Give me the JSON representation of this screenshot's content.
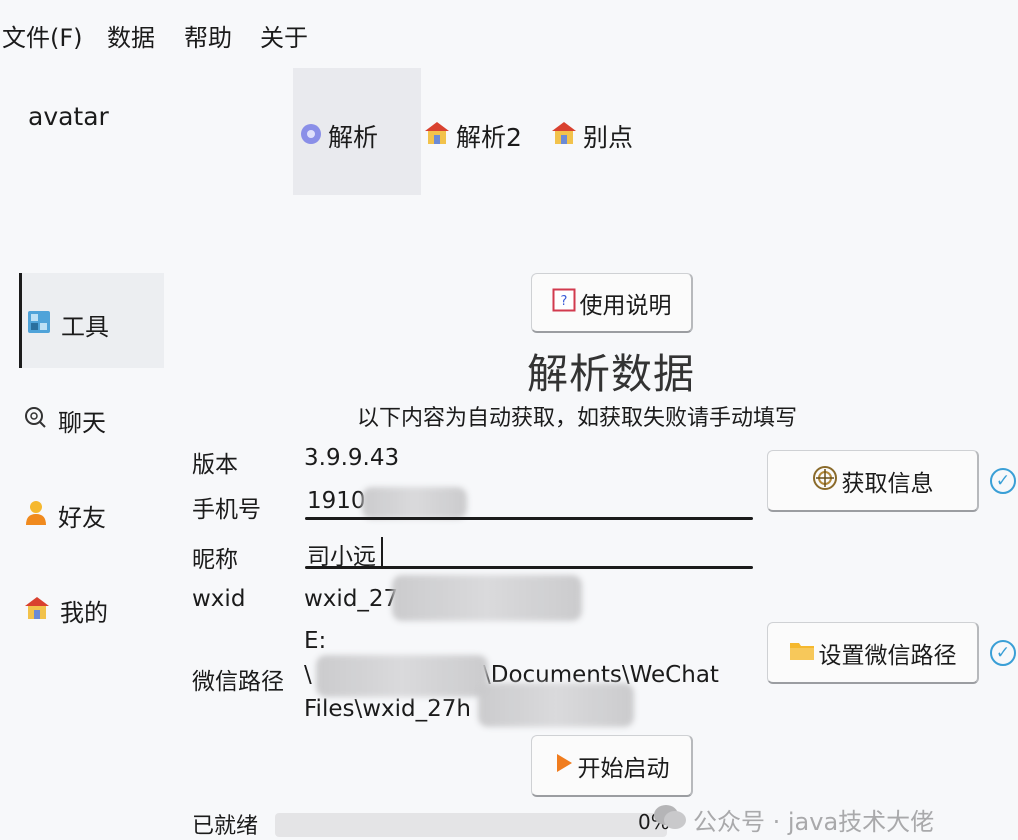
{
  "menubar": {
    "items": [
      "文件(F)",
      "数据",
      "帮助",
      "关于"
    ]
  },
  "header": {
    "avatar_label": "avatar",
    "tabs": [
      {
        "label": "解析",
        "icon": "disc-icon",
        "active": true
      },
      {
        "label": "解析2",
        "icon": "house-icon",
        "active": false
      },
      {
        "label": "别点",
        "icon": "house-icon",
        "active": false
      }
    ]
  },
  "sidebar": {
    "items": [
      {
        "label": "工具",
        "icon": "tool-icon",
        "active": true
      },
      {
        "label": "聊天",
        "icon": "chat-icon",
        "active": false
      },
      {
        "label": "好友",
        "icon": "person-icon",
        "active": false
      },
      {
        "label": "我的",
        "icon": "house-icon",
        "active": false
      }
    ]
  },
  "main": {
    "help_button": "使用说明",
    "title": "解析数据",
    "subtitle": "以下内容为自动获取，如获取失败请手动填写",
    "fields": {
      "version_label": "版本",
      "version_value": "3.9.9.43",
      "phone_label": "手机号",
      "phone_value": "1910",
      "nickname_label": "昵称",
      "nickname_value": "司小远",
      "wxid_label": "wxid",
      "wxid_value": "wxid_27",
      "path_label": "微信路径",
      "path_line1": "E:",
      "path_line2": "\\",
      "path_line2_b": "\\Documents\\WeChat",
      "path_line3": "Files\\wxid_27h"
    },
    "get_info_button": "获取信息",
    "set_path_button": "设置微信路径",
    "start_button": "开始启动",
    "status": "已就绪",
    "progress_percent": "0%",
    "progress_value": 0
  },
  "watermark": "公众号 · java技术大佬",
  "colors": {
    "accent": "#3a9fd6",
    "play_orange": "#f07c1e",
    "folder_yellow": "#f5b82e"
  }
}
